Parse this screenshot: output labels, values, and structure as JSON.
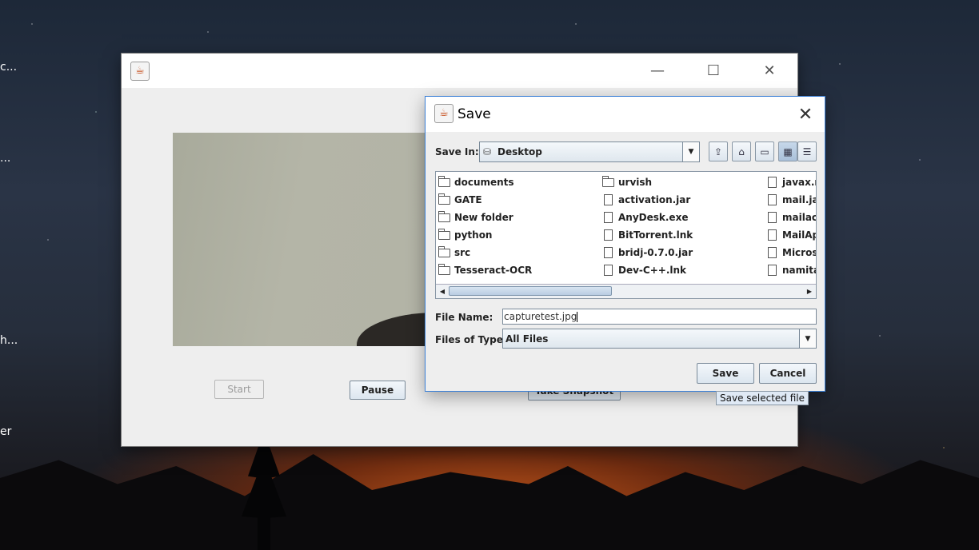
{
  "desktop": {
    "icon_labels": [
      "c...",
      "...",
      "h...",
      "er"
    ]
  },
  "main_window": {
    "buttons": {
      "start": "Start",
      "pause": "Pause",
      "snapshot": "Take Snapshot"
    }
  },
  "dialog": {
    "title": "Save",
    "save_in_label": "Save In:",
    "location": "Desktop",
    "files": {
      "col1": [
        {
          "name": "documents",
          "type": "folder"
        },
        {
          "name": "GATE",
          "type": "folder"
        },
        {
          "name": "New folder",
          "type": "folder"
        },
        {
          "name": "python",
          "type": "folder"
        },
        {
          "name": "src",
          "type": "folder"
        },
        {
          "name": "Tesseract-OCR",
          "type": "folder"
        }
      ],
      "col2": [
        {
          "name": "urvish",
          "type": "folder"
        },
        {
          "name": "activation.jar",
          "type": "file"
        },
        {
          "name": "AnyDesk.exe",
          "type": "file"
        },
        {
          "name": "BitTorrent.lnk",
          "type": "file"
        },
        {
          "name": "bridj-0.7.0.jar",
          "type": "file"
        },
        {
          "name": "Dev-C++.lnk",
          "type": "file"
        }
      ],
      "col3": [
        {
          "name": "javax.m",
          "type": "file"
        },
        {
          "name": "mail.jar",
          "type": "file"
        },
        {
          "name": "mailact",
          "type": "file"
        },
        {
          "name": "MailApp",
          "type": "file"
        },
        {
          "name": "Microso",
          "type": "file"
        },
        {
          "name": "namita.",
          "type": "file"
        }
      ]
    },
    "file_name_label": "File Name:",
    "file_name_value": "capturetest.jpg",
    "files_of_type_label": "Files of Type:",
    "files_of_type_value": "All Files",
    "save_button": "Save",
    "cancel_button": "Cancel",
    "tooltip": "Save selected file"
  }
}
